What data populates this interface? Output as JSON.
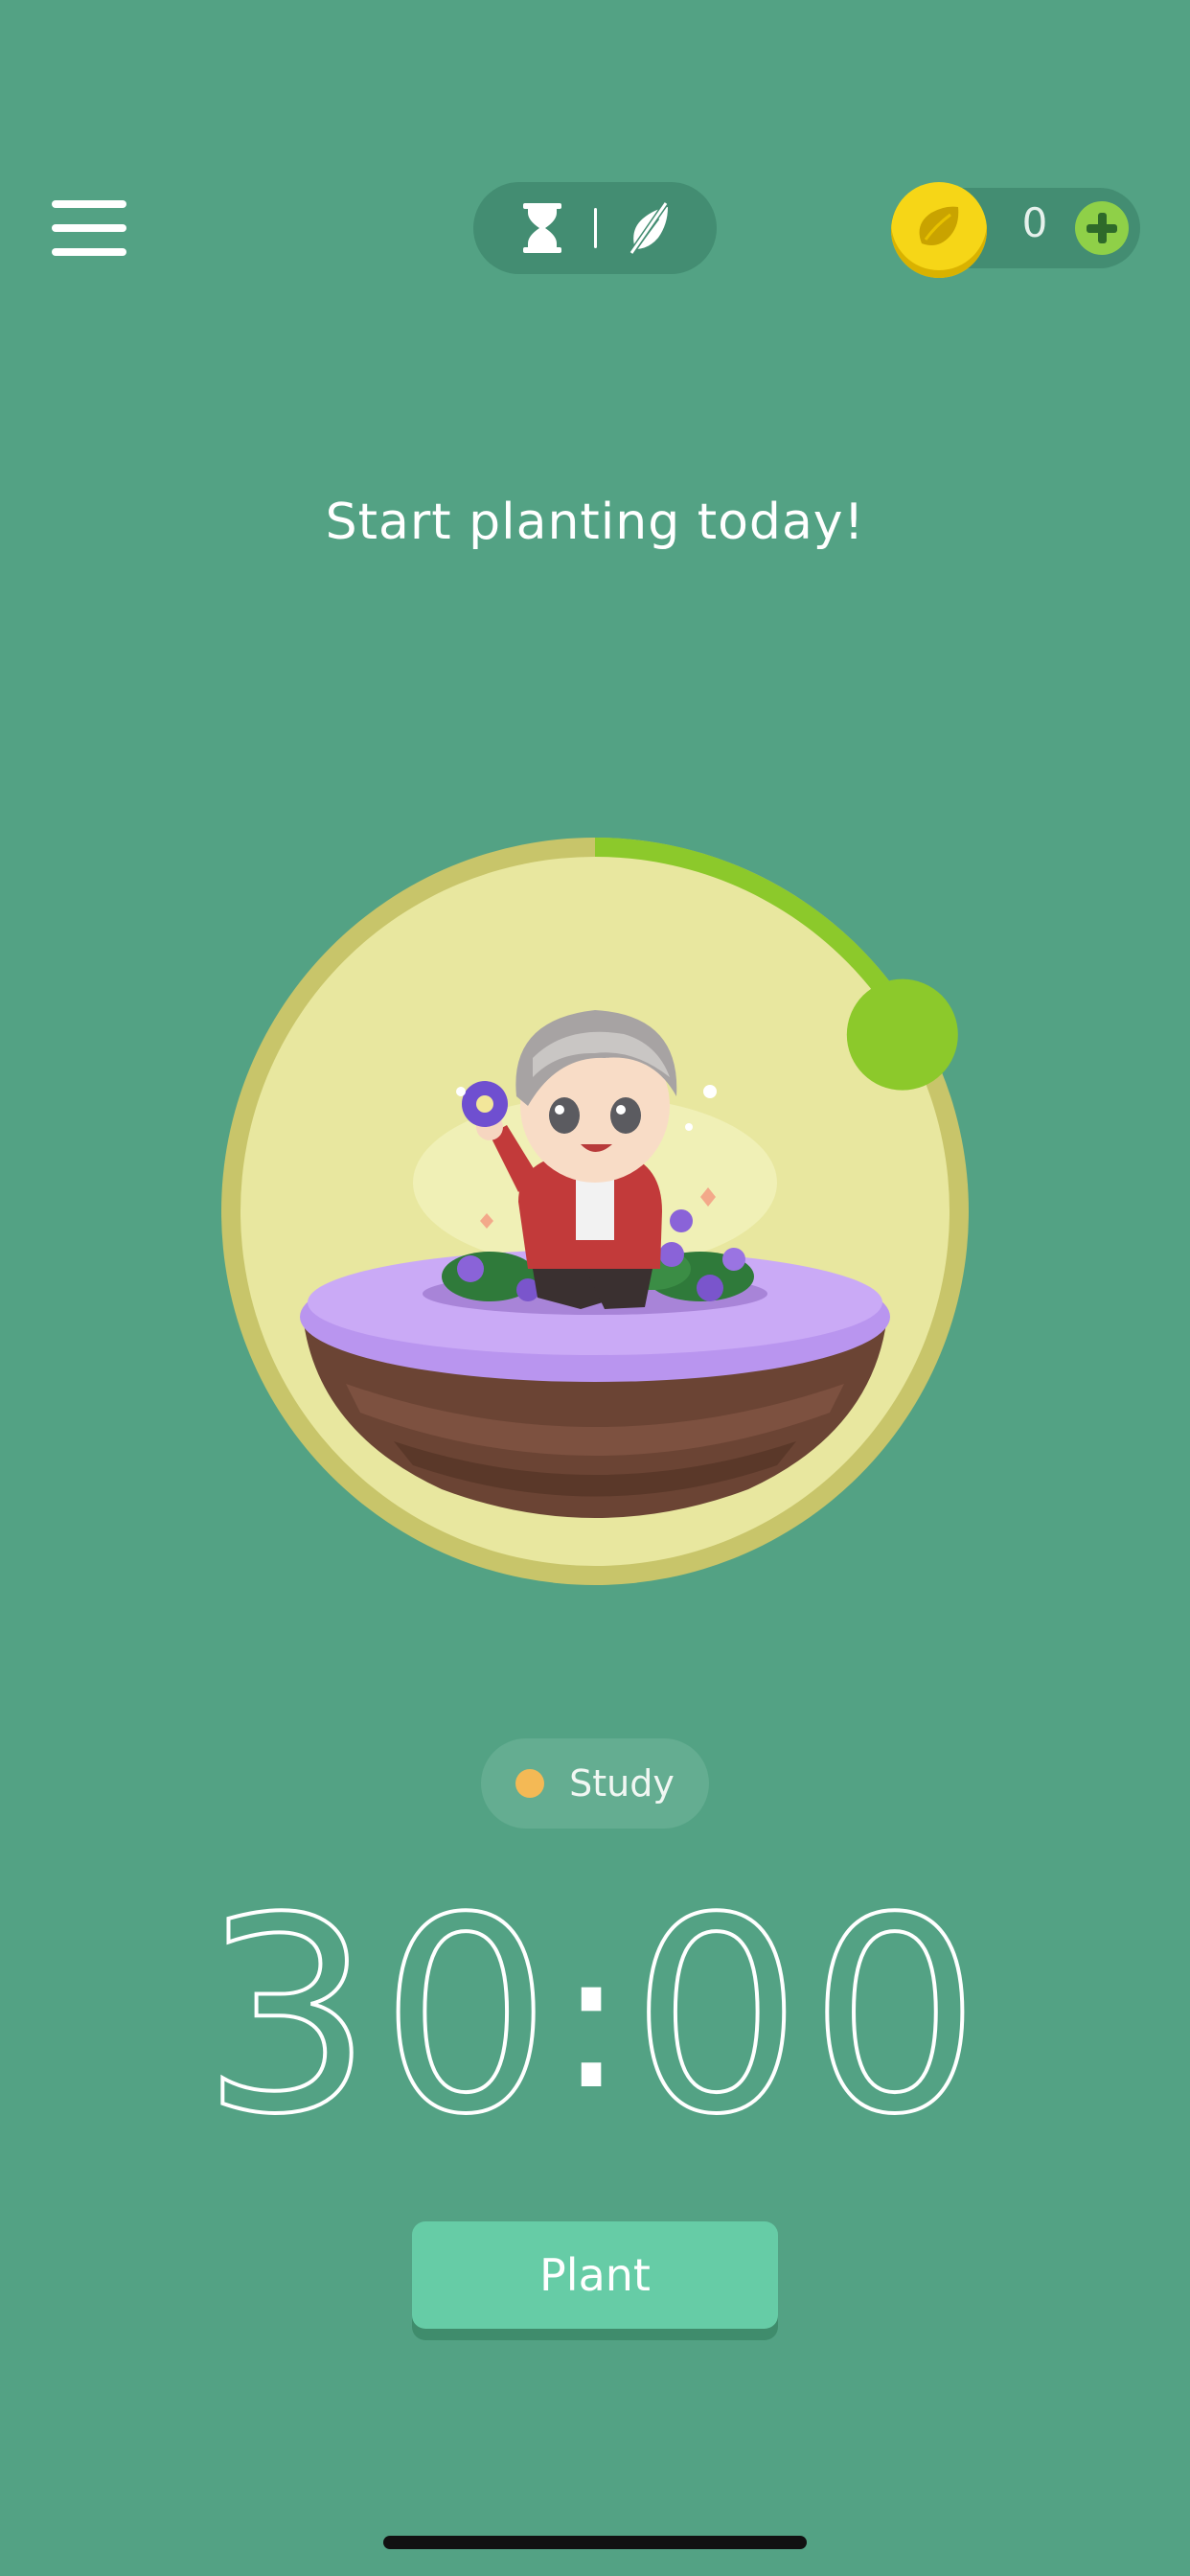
{
  "header": {
    "menu_icon": "hamburger-menu-icon",
    "mode_toggle": {
      "left_icon": "hourglass-icon",
      "right_icon": "no-grow-leaf-icon"
    },
    "coins": {
      "icon": "gold-seed-coin-icon",
      "count": "0",
      "add_icon": "plus-icon"
    }
  },
  "headline": "Start planting today!",
  "timer": {
    "progress": 0.167,
    "track_color": "#c8c56a",
    "fill_color": "#8cc92b",
    "inner_color": "#e8e79f"
  },
  "tag": {
    "label": "Study",
    "dot_color": "#f4b955"
  },
  "countdown": {
    "minutes": "30",
    "seconds": "00"
  },
  "plant_button": {
    "label": "Plant"
  },
  "colors": {
    "background": "#53a284",
    "accent": "#66cca6"
  }
}
